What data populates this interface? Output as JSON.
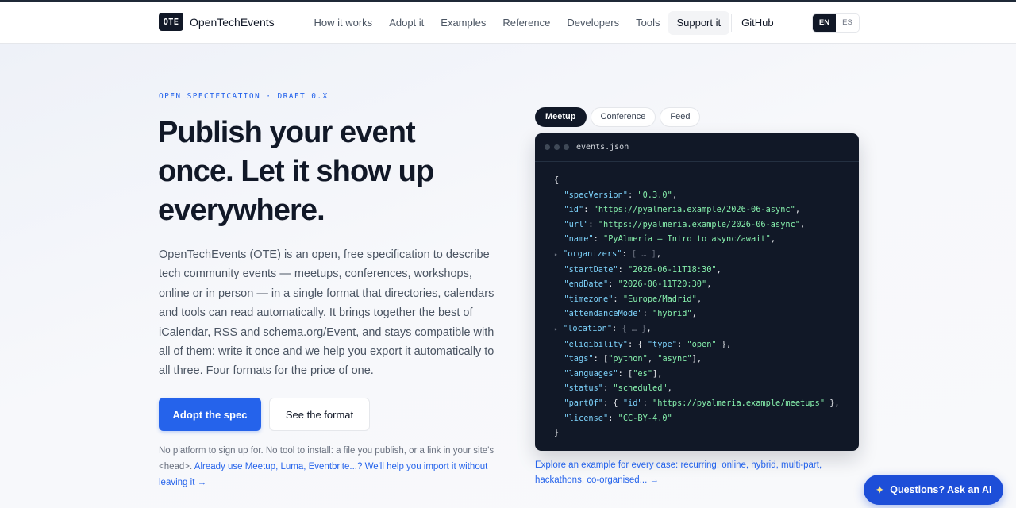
{
  "brand": {
    "logo": "OTE",
    "name": "OpenTechEvents"
  },
  "nav": {
    "items": [
      "How it works",
      "Adopt it",
      "Examples",
      "Reference",
      "Developers",
      "Tools",
      "Support it"
    ],
    "github": "GitHub",
    "active": "Support it"
  },
  "lang": {
    "en": "EN",
    "es": "ES",
    "selected": "EN"
  },
  "hero": {
    "eyebrow": "OPEN SPECIFICATION · DRAFT 0.X",
    "title": "Publish your event once. Let it show up everywhere.",
    "lead": "OpenTechEvents (OTE) is an open, free specification to describe tech community events — meetups, conferences, workshops, online or in person — in a single format that directories, calendars and tools can read automatically. It brings together the best of iCalendar, RSS and schema.org/Event, and stays compatible with all of them: write it once and we help you export it automatically to all three. Four formats for the price of one.",
    "cta_primary": "Adopt the spec",
    "cta_secondary": "See the format",
    "note_text": "No platform to sign up for. No tool to install: a file you publish, or a link in your site's <head>. ",
    "note_link": "Already use Meetup, Luma, Eventbrite...? We'll help you import it without leaving it →"
  },
  "example": {
    "tabs": [
      "Meetup",
      "Conference",
      "Feed"
    ],
    "active_tab": "Meetup",
    "filename": "events.json",
    "json": {
      "specVersion": "0.3.0",
      "id": "https://pyalmeria.example/2026-06-async",
      "url": "https://pyalmeria.example/2026-06-async",
      "name": "PyAlmería — Intro to async/await",
      "organizers_collapsed": "[ … ]",
      "startDate": "2026-06-11T18:30",
      "endDate": "2026-06-11T20:30",
      "timezone": "Europe/Madrid",
      "attendanceMode": "hybrid",
      "location_collapsed": "{ … }",
      "eligibility_type": "open",
      "tags": [
        "python",
        "async"
      ],
      "languages": [
        "es"
      ],
      "status": "scheduled",
      "partOf_id": "https://pyalmeria.example/meetups",
      "license": "CC-BY-4.0"
    },
    "explore": "Explore an example for every case: recurring, online, hybrid, multi-part, hackathons, co-organised... →"
  },
  "assistant": {
    "label": "Questions? Ask an AI",
    "icon": "sparkle-icon"
  },
  "colors": {
    "accent": "#2563eb",
    "dark": "#111827",
    "code_key": "#7dd3fc",
    "code_string": "#86efac"
  }
}
